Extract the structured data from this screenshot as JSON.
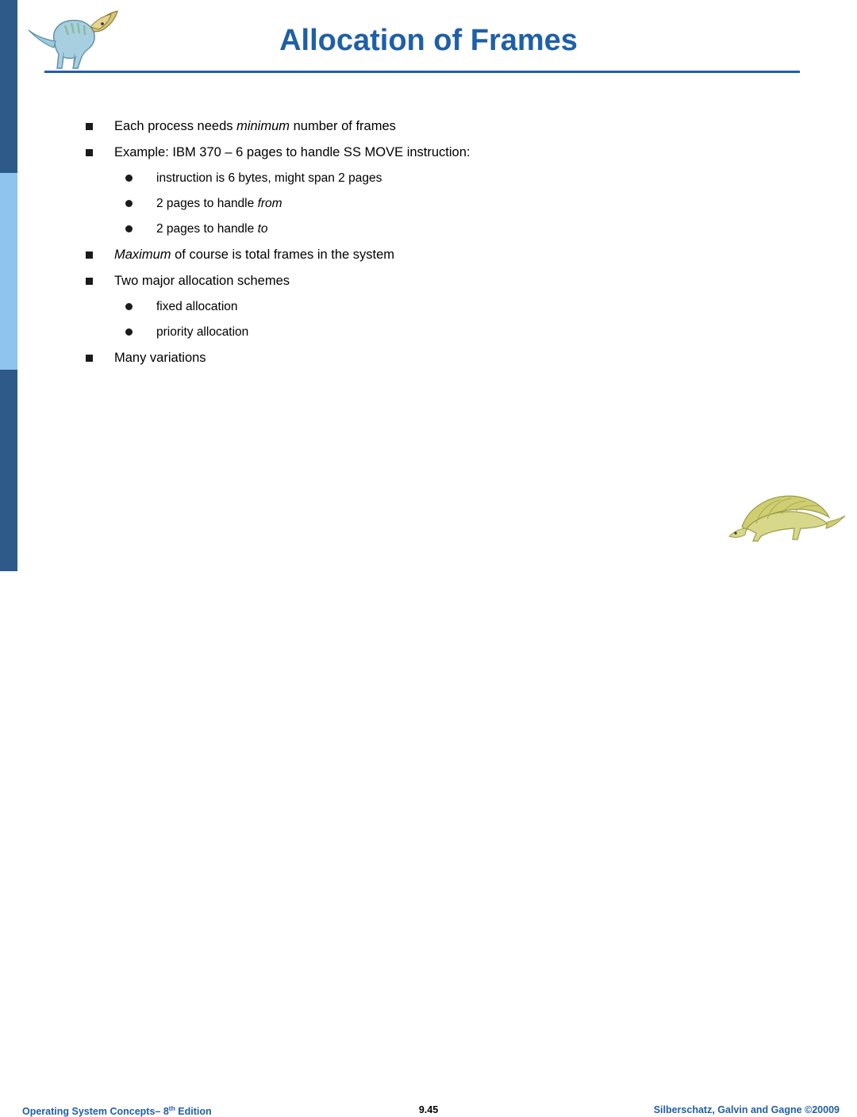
{
  "slide": {
    "title": "Allocation of Frames",
    "accent_color": "#1f5fa8",
    "sidebar_colors": [
      "#2e5a8a",
      "#8fc4ee",
      "#2e5a8a"
    ],
    "bullets": [
      {
        "level": 1,
        "segments": [
          {
            "text": "Each process needs ",
            "italic": false
          },
          {
            "text": "minimum",
            "italic": true
          },
          {
            "text": " number of frames",
            "italic": false
          }
        ]
      },
      {
        "level": 1,
        "segments": [
          {
            "text": "Example:  IBM 370 – 6 pages to handle SS MOVE instruction:",
            "italic": false
          }
        ]
      },
      {
        "level": 2,
        "segments": [
          {
            "text": "instruction is 6 bytes, might span 2 pages",
            "italic": false
          }
        ]
      },
      {
        "level": 2,
        "segments": [
          {
            "text": "2 pages to handle ",
            "italic": false
          },
          {
            "text": "from",
            "italic": true
          }
        ]
      },
      {
        "level": 2,
        "segments": [
          {
            "text": "2 pages to handle ",
            "italic": false
          },
          {
            "text": "to",
            "italic": true
          }
        ]
      },
      {
        "level": 1,
        "segments": [
          {
            "text": "Maximum",
            "italic": true
          },
          {
            "text": " of course is total frames in the system",
            "italic": false
          }
        ]
      },
      {
        "level": 1,
        "segments": [
          {
            "text": "Two major allocation schemes",
            "italic": false
          }
        ]
      },
      {
        "level": 2,
        "segments": [
          {
            "text": "fixed allocation",
            "italic": false
          }
        ]
      },
      {
        "level": 2,
        "segments": [
          {
            "text": "priority allocation",
            "italic": false
          }
        ]
      },
      {
        "level": 1,
        "segments": [
          {
            "text": "Many variations",
            "italic": false
          }
        ]
      }
    ]
  },
  "footer": {
    "left_text": "Operating System Concepts– 8",
    "left_sup": "th",
    "left_suffix": " Edition",
    "page_number": "9.45",
    "right_text": "Silberschatz, Galvin and Gagne ©20009"
  },
  "icons": {
    "top_logo": "dinosaur-logo",
    "bottom_logo": "dinosaur-logo"
  }
}
